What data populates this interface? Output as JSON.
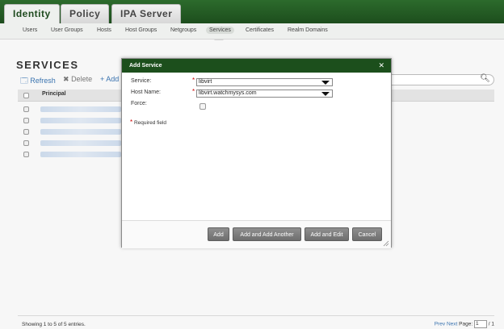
{
  "top_tabs": [
    {
      "label": "Identity",
      "active": true
    },
    {
      "label": "Policy",
      "active": false
    },
    {
      "label": "IPA Server",
      "active": false
    }
  ],
  "sub_nav": [
    {
      "label": "Users"
    },
    {
      "label": "User Groups"
    },
    {
      "label": "Hosts"
    },
    {
      "label": "Host Groups"
    },
    {
      "label": "Netgroups"
    },
    {
      "label": "Services",
      "active": true
    },
    {
      "label": "Certificates"
    },
    {
      "label": "Realm Domains"
    }
  ],
  "page": {
    "title": "SERVICES",
    "actions": {
      "refresh": "Refresh",
      "delete": "Delete",
      "add": "Add"
    },
    "table": {
      "header_principal": "Principal",
      "row_count_visible": 5
    },
    "footer": {
      "showing": "Showing 1 to 5 of 5 entries.",
      "prev": "Prev",
      "next": "Next",
      "page_label": "Page:",
      "page_value": "1",
      "page_total": "/ 1"
    }
  },
  "dialog": {
    "title": "Add Service",
    "fields": {
      "service_label": "Service:",
      "service_value": "libvirt",
      "host_label": "Host Name:",
      "host_value": "libvirt.watchmysys.com",
      "force_label": "Force:"
    },
    "required_note": "Required field",
    "buttons": {
      "add": "Add",
      "add_another": "Add and Add Another",
      "add_edit": "Add and Edit",
      "cancel": "Cancel"
    }
  },
  "colors": {
    "header_green": "#1d4d1d",
    "link_blue": "#3b74b0",
    "required_red": "#cc0000"
  }
}
